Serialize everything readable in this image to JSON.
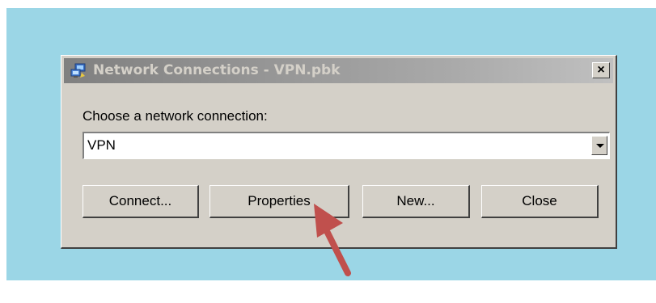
{
  "window": {
    "title": "Network Connections - VPN.pbk",
    "close_glyph": "×"
  },
  "form": {
    "label": "Choose a network connection:",
    "selected_connection": "VPN"
  },
  "buttons": {
    "connect": "Connect...",
    "properties": "Properties",
    "new": "New...",
    "close": "Close"
  },
  "colors": {
    "backdrop": "#9bd6e6",
    "dialog_face": "#d4d0c8",
    "annotation_arrow": "#c0504d"
  },
  "icons": {
    "title": "network-connections-icon",
    "annotation": "red-pointer-arrow"
  }
}
